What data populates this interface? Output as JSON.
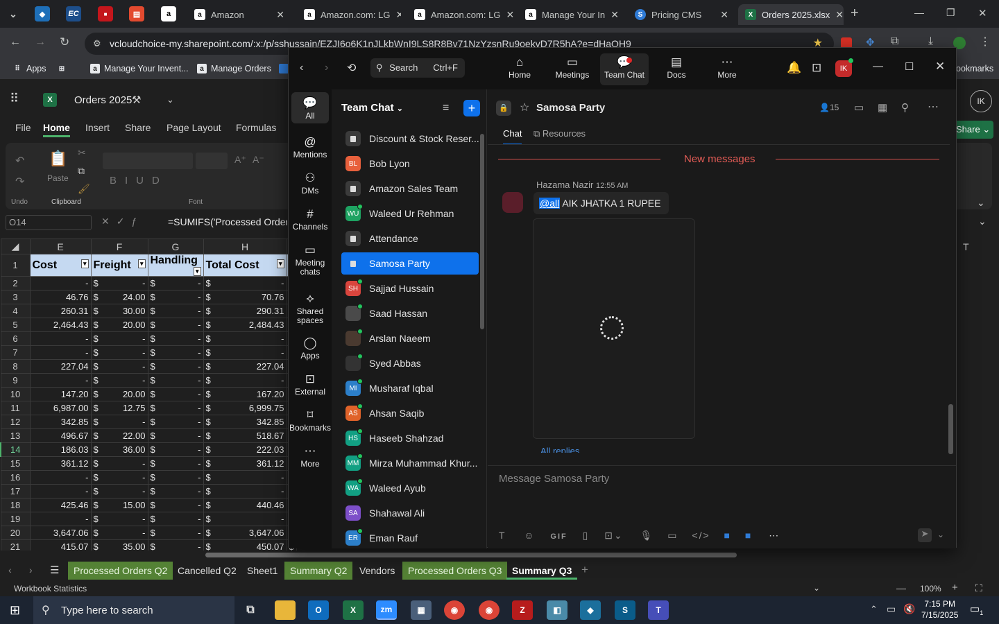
{
  "browser": {
    "tabs": [
      {
        "label": "Amazon",
        "icon": "amazon-icon"
      },
      {
        "label": "Amazon.com: LG",
        "icon": "amazon-icon"
      },
      {
        "label": "Amazon.com: LG",
        "icon": "amazon-icon"
      },
      {
        "label": "Manage Your In",
        "icon": "amazon-icon"
      },
      {
        "label": "Pricing CMS",
        "icon": "wordpress-icon"
      },
      {
        "label": "Orders 2025.xlsx",
        "icon": "excel-icon"
      }
    ],
    "new_tab": "+",
    "url": "vcloudchoice-my.sharepoint.com/:x:/p/sshussain/EZJI6o6K1nJLkbWnI9LS8R8Bv71NzYzsnRu9oekvD7R5hA?e=dHaOH9",
    "bookmarks": [
      {
        "label": "Apps"
      },
      {
        "label": "Manage Your Invent..."
      },
      {
        "label": "Manage Orders"
      }
    ],
    "bookmarks_right": "ookmarks"
  },
  "excel": {
    "title": "Orders 2025",
    "ribbon_tabs": [
      "File",
      "Home",
      "Insert",
      "Share",
      "Page Layout",
      "Formulas"
    ],
    "active_tab": "Home",
    "share_label": "Share",
    "user_initials": "IK",
    "groups": {
      "undo": "Undo",
      "clipboard": "Clipboard",
      "font": "Font",
      "paste": "Paste"
    },
    "name_box": "O14",
    "formula": "=SUMIFS('Processed Orders Q",
    "col_headers": [
      "E",
      "F",
      "G",
      "H"
    ],
    "col_t": "T",
    "header_row": [
      "Cost",
      "Freight",
      "Handling",
      "Total Cost"
    ],
    "rows": [
      {
        "n": "1"
      },
      {
        "n": "2",
        "e": "-",
        "f": "-",
        "g": "-",
        "h": "-"
      },
      {
        "n": "3",
        "e": "46.76",
        "f": "24.00",
        "g": "-",
        "h": "70.76"
      },
      {
        "n": "4",
        "e": "260.31",
        "f": "30.00",
        "g": "-",
        "h": "290.31"
      },
      {
        "n": "5",
        "e": "2,464.43",
        "f": "20.00",
        "g": "-",
        "h": "2,484.43"
      },
      {
        "n": "6",
        "e": "-",
        "f": "-",
        "g": "-",
        "h": "-"
      },
      {
        "n": "7",
        "e": "-",
        "f": "-",
        "g": "-",
        "h": "-"
      },
      {
        "n": "8",
        "e": "227.04",
        "f": "-",
        "g": "-",
        "h": "227.04"
      },
      {
        "n": "9",
        "e": "-",
        "f": "-",
        "g": "-",
        "h": "-"
      },
      {
        "n": "10",
        "e": "147.20",
        "f": "20.00",
        "g": "-",
        "h": "167.20"
      },
      {
        "n": "11",
        "e": "6,987.00",
        "f": "12.75",
        "g": "-",
        "h": "6,999.75"
      },
      {
        "n": "12",
        "e": "342.85",
        "f": "-",
        "g": "-",
        "h": "342.85"
      },
      {
        "n": "13",
        "e": "496.67",
        "f": "22.00",
        "g": "-",
        "h": "518.67"
      },
      {
        "n": "14",
        "e": "186.03",
        "f": "36.00",
        "g": "-",
        "h": "222.03"
      },
      {
        "n": "15",
        "e": "361.12",
        "f": "-",
        "g": "-",
        "h": "361.12"
      },
      {
        "n": "16",
        "e": "-",
        "f": "-",
        "g": "-",
        "h": "-"
      },
      {
        "n": "17",
        "e": "-",
        "f": "-",
        "g": "-",
        "h": "-"
      },
      {
        "n": "18",
        "e": "425.46",
        "f": "15.00",
        "g": "-",
        "h": "440.46"
      },
      {
        "n": "19",
        "e": "-",
        "f": "-",
        "g": "-",
        "h": "-"
      },
      {
        "n": "20",
        "e": "3,647.06",
        "f": "-",
        "g": "-",
        "h": "3,647.06"
      },
      {
        "n": "21",
        "e": "415.07",
        "f": "35.00",
        "g": "-",
        "h": "450.07"
      }
    ],
    "dollar": "$",
    "sheet_tabs": [
      {
        "label": "Processed Orders Q2",
        "green": true
      },
      {
        "label": "Cancelled Q2",
        "green": false
      },
      {
        "label": "Sheet1",
        "green": false
      },
      {
        "label": "Summary Q2",
        "green": true
      },
      {
        "label": "Vendors",
        "green": false
      },
      {
        "label": "Processed Orders Q3",
        "green": true
      },
      {
        "label": "Summary Q3",
        "green": false,
        "active": true
      }
    ],
    "status_left": "Workbook Statistics",
    "zoom": "100%"
  },
  "zoom": {
    "search_placeholder": "Search",
    "search_shortcut": "Ctrl+F",
    "top_nav": [
      {
        "label": "Home",
        "icon": "home-icon"
      },
      {
        "label": "Meetings",
        "icon": "video-icon"
      },
      {
        "label": "Team Chat",
        "icon": "chat-icon",
        "active": true
      },
      {
        "label": "Docs",
        "icon": "docs-icon"
      },
      {
        "label": "More",
        "icon": "more-icon"
      }
    ],
    "avatar_initials": "IK",
    "left_nav": [
      {
        "label": "All",
        "icon": "chat-bubble-icon",
        "active": true
      },
      {
        "label": "Mentions",
        "icon": "at-icon"
      },
      {
        "label": "DMs",
        "icon": "people-icon"
      },
      {
        "label": "Channels",
        "icon": "hash-icon"
      },
      {
        "label": "Meeting chats",
        "icon": "calendar-icon"
      },
      {
        "label": "Shared spaces",
        "icon": "share-icon"
      },
      {
        "label": "Apps",
        "icon": "apps-icon"
      },
      {
        "label": "External",
        "icon": "external-icon"
      },
      {
        "label": "Bookmarks",
        "icon": "bookmark-icon"
      },
      {
        "label": "More",
        "icon": "more-icon"
      }
    ],
    "list_title": "Team Chat",
    "conversations": [
      {
        "label": "Discount & Stock Reser...",
        "type": "lock"
      },
      {
        "label": "Bob Lyon",
        "initials": "BL",
        "color": "#e8603c",
        "dot": false
      },
      {
        "label": "Amazon Sales Team",
        "type": "lock"
      },
      {
        "label": "Waleed Ur Rehman",
        "initials": "WU",
        "color": "#1ea362",
        "dot": true
      },
      {
        "label": "Attendance",
        "type": "lock"
      },
      {
        "label": "Samosa Party",
        "type": "lock",
        "selected": true
      },
      {
        "label": "Sajjad Hussain",
        "initials": "SH",
        "color": "#d9453d",
        "dot": true
      },
      {
        "label": "Saad Hassan",
        "initials": "",
        "color": "#4a4a4a",
        "dot": true
      },
      {
        "label": "Arslan Naeem",
        "initials": "",
        "color": "#4a3a30",
        "dot": true
      },
      {
        "label": "Syed Abbas",
        "initials": "",
        "color": "#333333",
        "dot": true
      },
      {
        "label": "Musharaf Iqbal",
        "initials": "MI",
        "color": "#2c7fc9",
        "dot": true
      },
      {
        "label": "Ahsan Saqib",
        "initials": "AS",
        "color": "#e0632a",
        "dot": true
      },
      {
        "label": "Haseeb Shahzad",
        "initials": "HS",
        "color": "#12a083",
        "dot": true
      },
      {
        "label": "Mirza Muhammad Khur...",
        "initials": "MM",
        "color": "#12a083",
        "dot": true
      },
      {
        "label": "Waleed Ayub",
        "initials": "WA",
        "color": "#12a083",
        "dot": true
      },
      {
        "label": "Shahawal Ali",
        "initials": "SA",
        "color": "#7d4fc9",
        "dot": false
      },
      {
        "label": "Eman Rauf",
        "initials": "ER",
        "color": "#2c7fc9",
        "dot": true
      }
    ],
    "channel_name": "Samosa Party",
    "member_count": "15",
    "tabs": [
      "Chat",
      "Resources"
    ],
    "new_messages": "New messages",
    "message": {
      "sender": "Hazama Nazir",
      "time": "12:55 AM",
      "mention": "@all",
      "text": " AIK JHATKA 1 RUPEE",
      "replies": "All replies"
    },
    "composer_placeholder": "Message Samosa Party",
    "composer_gif": "GIF"
  },
  "taskbar": {
    "search_placeholder": "Type here to search",
    "time": "7:15 PM",
    "date": "7/15/2025",
    "notifications": "1"
  }
}
